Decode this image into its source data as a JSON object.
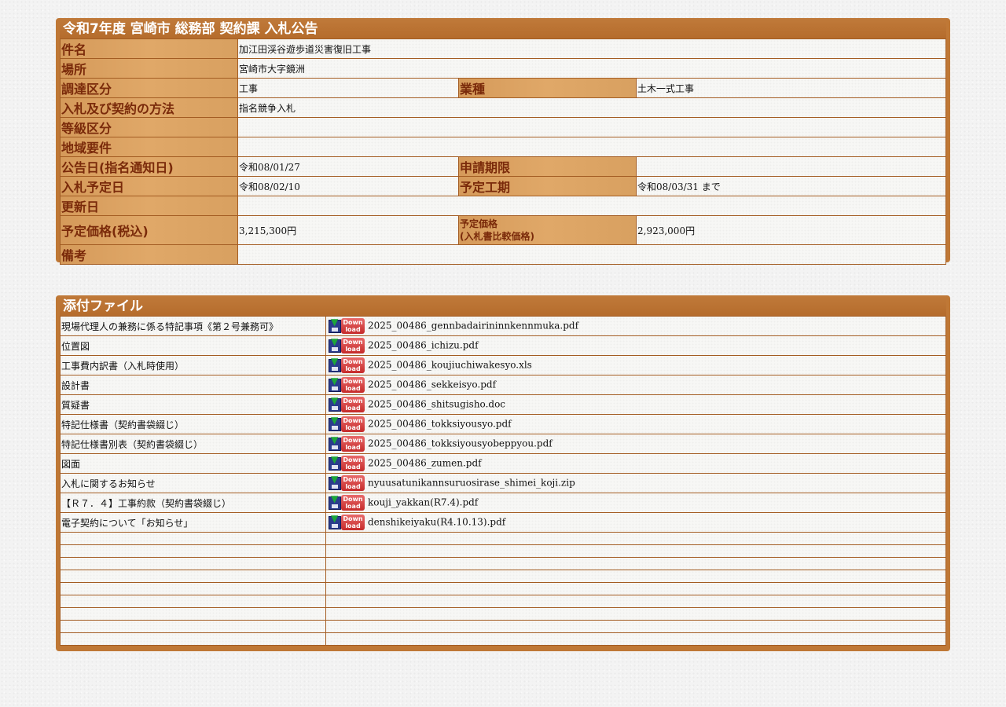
{
  "info": {
    "title": "令和7年度 宮崎市 総務部 契約課 入札公告",
    "rows": {
      "subject": {
        "label": "件名",
        "value": "加江田渓谷遊歩道災害復旧工事"
      },
      "location": {
        "label": "場所",
        "value": "宮崎市大字鏡洲"
      },
      "procurement": {
        "label": "調達区分",
        "value": "工事",
        "label2": "業種",
        "value2": "土木一式工事"
      },
      "method": {
        "label": "入札及び契約の方法",
        "value": "指名競争入札"
      },
      "grade": {
        "label": "等級区分",
        "value": ""
      },
      "region": {
        "label": "地域要件",
        "value": ""
      },
      "notice_date": {
        "label": "公告日(指名通知日)",
        "value": "令和08/01/27",
        "label2": "申請期限",
        "value2": ""
      },
      "bid_date": {
        "label": "入札予定日",
        "value": "令和08/02/10",
        "label2": "予定工期",
        "value2": "令和08/03/31 まで"
      },
      "updated": {
        "label": "更新日",
        "value": ""
      },
      "price": {
        "label": "予定価格(税込)",
        "value": "3,215,300円",
        "label2_line1": "予定価格",
        "label2_line2": "(入札書比較価格)",
        "value2": "2,923,000円"
      },
      "remarks": {
        "label": "備考",
        "value": ""
      }
    }
  },
  "files": {
    "title": "添付ファイル",
    "download_label_top": "Down",
    "download_label_bottom": "load",
    "items": [
      {
        "desc": "現場代理人の兼務に係る特記事項《第２号兼務可》",
        "file": "2025_00486_gennbadairininnkennmuka.pdf"
      },
      {
        "desc": "位置図",
        "file": "2025_00486_ichizu.pdf"
      },
      {
        "desc": "工事費内訳書（入札時使用）",
        "file": "2025_00486_koujiuchiwakesyo.xls"
      },
      {
        "desc": "設計書",
        "file": "2025_00486_sekkeisyo.pdf"
      },
      {
        "desc": "質疑書",
        "file": "2025_00486_shitsugisho.doc"
      },
      {
        "desc": "特記仕様書（契約書袋綴じ）",
        "file": "2025_00486_tokksiyousyo.pdf"
      },
      {
        "desc": "特記仕様書別表（契約書袋綴じ）",
        "file": "2025_00486_tokksiyousyobeppyou.pdf"
      },
      {
        "desc": "図面",
        "file": "2025_00486_zumen.pdf"
      },
      {
        "desc": "入札に関するお知らせ",
        "file": "nyuusatunikannsuruosirase_shimei_koji.zip"
      },
      {
        "desc": "【Ｒ７．４】工事約款（契約書袋綴じ）",
        "file": "kouji_yakkan(R7.4).pdf"
      },
      {
        "desc": "電子契約について「お知らせ」",
        "file": "denshikeiyaku(R4.10.13).pdf"
      }
    ],
    "empty_rows": 9
  }
}
